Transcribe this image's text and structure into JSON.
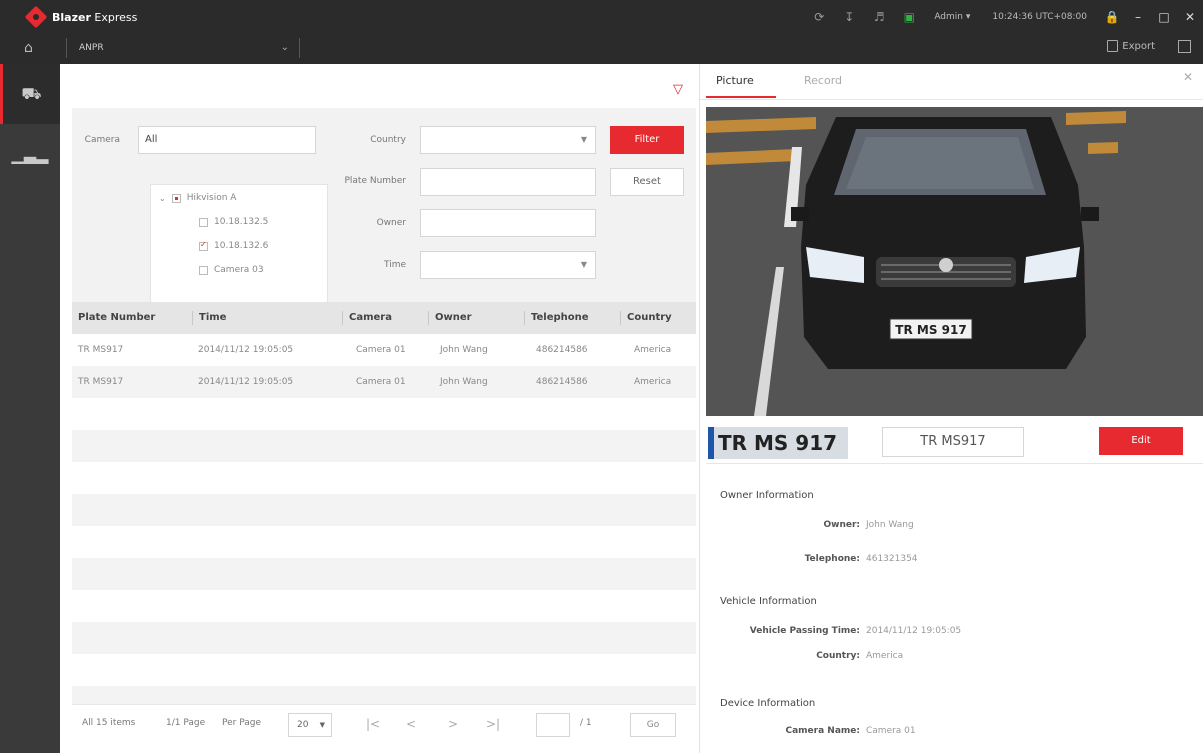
{
  "app": {
    "brand_bold": "Blazer",
    "brand_rest": " Express",
    "module": "ANPR"
  },
  "topbar": {
    "user": "Admin",
    "clock": "10:24:36 UTC+08:00",
    "export_label": "Export"
  },
  "filters": {
    "camera_label": "Camera",
    "camera_value": "All",
    "country_label": "Country",
    "plate_label": "Plate Number",
    "owner_label": "Owner",
    "time_label": "Time",
    "filter_button": "Filter",
    "reset_button": "Reset",
    "tree": {
      "group": "Hikvision A",
      "items": [
        {
          "label": "10.18.132.5",
          "checked": false
        },
        {
          "label": "10.18.132.6",
          "checked": true
        },
        {
          "label": "Camera 03",
          "checked": false
        }
      ]
    }
  },
  "table": {
    "headers": [
      "Plate Number",
      "Time",
      "Camera",
      "Owner",
      "Telephone",
      "Country"
    ],
    "rows": [
      [
        "TR MS917",
        "2014/11/12 19:05:05",
        "Camera 01",
        "John Wang",
        "486214586",
        "America"
      ],
      [
        "TR MS917",
        "2014/11/12 19:05:05",
        "Camera 01",
        "John Wang",
        "486214586",
        "America"
      ]
    ]
  },
  "pager": {
    "total": "All 15 items",
    "page": "1/1 Page",
    "per_page_label": "Per Page",
    "per_page_value": "20",
    "page_total": "/ 1",
    "go": "Go"
  },
  "detail": {
    "tabs": [
      "Picture",
      "Record"
    ],
    "plate_crop": "TR MS 917",
    "plate_text": "TR MS917",
    "edit_button": "Edit",
    "owner_section": "Owner Information",
    "owner_label": "Owner:",
    "owner_value": "John Wang",
    "telephone_label": "Telephone:",
    "telephone_value": "461321354",
    "vehicle_section": "Vehicle Information",
    "passing_label": "Vehicle Passing Time:",
    "passing_value": "2014/11/12 19:05:05",
    "country_label": "Country:",
    "country_value": "America",
    "device_section": "Device Information",
    "camera_label": "Camera Name:",
    "camera_value": "Camera 01",
    "photo_plate": "TR MS 917"
  }
}
